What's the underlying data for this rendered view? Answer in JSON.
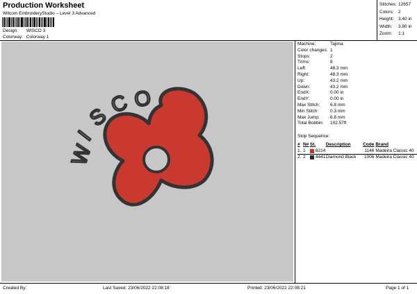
{
  "header": {
    "title": "Production Worksheet",
    "subtitle": "Wilcom EmbroideryStudio – Level 3 Advanced",
    "design_label": "Design:",
    "design_value": "WISCO 3",
    "colorway_label": "Colorway:",
    "colorway_value": "Colorway 1"
  },
  "stats": [
    {
      "label": "Stitches:",
      "value": "12657"
    },
    {
      "label": "Colors:",
      "value": "2"
    },
    {
      "label": "Height:",
      "value": "3.40 in"
    },
    {
      "label": "Width:",
      "value": "3.80 in"
    },
    {
      "label": "Zoom:",
      "value": "1:1"
    }
  ],
  "details": [
    {
      "label": "Machine:",
      "value": "Tajima"
    },
    {
      "label": "Color changes:",
      "value": "1"
    },
    {
      "label": "Stops:",
      "value": "2"
    },
    {
      "label": "Trims:",
      "value": "8"
    },
    {
      "label": "Left:",
      "value": "48.3 mm"
    },
    {
      "label": "Right:",
      "value": "48.3 mm"
    },
    {
      "label": "Up:",
      "value": "43.2 mm"
    },
    {
      "label": "Down:",
      "value": "43.2 mm"
    },
    {
      "label": "EndX:",
      "value": "0.00 in"
    },
    {
      "label": "EndY:",
      "value": "0.00 in"
    },
    {
      "label": "Max Stitch:",
      "value": "6.8 mm"
    },
    {
      "label": "Min Stitch:",
      "value": "0.3 mm"
    },
    {
      "label": "Max Jump:",
      "value": "6.8 mm"
    },
    {
      "label": "Total Bobbin:",
      "value": "102.57ft"
    }
  ],
  "stop_sequence": {
    "title": "Stop Sequence:",
    "headers": [
      "#",
      "N#",
      "St.",
      "Description",
      "Code",
      "Brand"
    ],
    "rows": [
      {
        "num": "1.",
        "n": "1",
        "color": "#c8302c",
        "st": "8214",
        "description": "",
        "code": "1146",
        "brand": "Madeira Classic 40"
      },
      {
        "num": "2.",
        "n": "2",
        "color": "#2a2a2a",
        "st": "4441",
        "description": "Diamond Black",
        "code": "1006",
        "brand": "Madeira Classic 40"
      }
    ]
  },
  "design": {
    "text": "WISCO",
    "fill_color": "#cc3a30",
    "outline_color": "#333333",
    "background": "#c7c7c7"
  },
  "footer": {
    "created_by": "Created By:",
    "last_saved": "Last Saved: 23/06/2022 22:08:18",
    "printed": "Printed: 23/06/2022 22:08:21",
    "page": "Page 1 of 1"
  }
}
